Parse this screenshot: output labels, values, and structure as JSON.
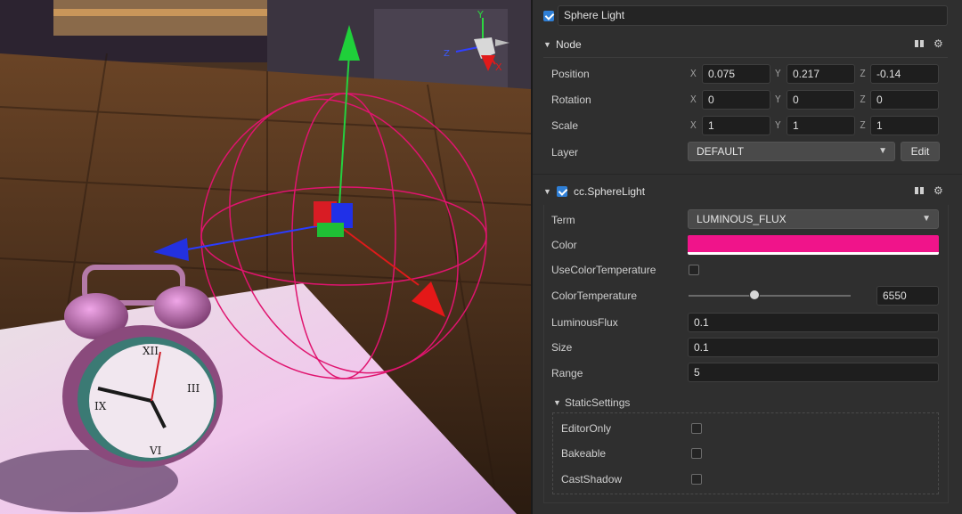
{
  "colors": {
    "sphere_color": "#f0148a",
    "accent": "#2f7fd6"
  },
  "header": {
    "name": "Sphere Light"
  },
  "node": {
    "title": "Node",
    "position": {
      "label": "Position",
      "x": "0.075",
      "y": "0.217",
      "z": "-0.14"
    },
    "rotation": {
      "label": "Rotation",
      "x": "0",
      "y": "0",
      "z": "0"
    },
    "scale": {
      "label": "Scale",
      "x": "1",
      "y": "1",
      "z": "1"
    },
    "layer": {
      "label": "Layer",
      "value": "DEFAULT",
      "edit_label": "Edit"
    },
    "axes": {
      "x": "X",
      "y": "Y",
      "z": "Z"
    }
  },
  "component": {
    "title": "cc.SphereLight",
    "term": {
      "label": "Term",
      "value": "LUMINOUS_FLUX"
    },
    "color": {
      "label": "Color"
    },
    "use_color_temperature": {
      "label": "UseColorTemperature"
    },
    "color_temperature": {
      "label": "ColorTemperature",
      "value": "6550",
      "slider_fraction": 0.4
    },
    "luminous_flux": {
      "label": "LuminousFlux",
      "value": "0.1"
    },
    "size": {
      "label": "Size",
      "value": "0.1"
    },
    "range": {
      "label": "Range",
      "value": "5"
    },
    "static_settings": {
      "title": "StaticSettings",
      "editor_only": {
        "label": "EditorOnly"
      },
      "bakeable": {
        "label": "Bakeable"
      },
      "cast_shadow": {
        "label": "CastShadow"
      }
    }
  },
  "gizmo": {
    "y_label": "Y",
    "x_label": "X",
    "z_label": "Z"
  },
  "icons": {
    "book": "book-icon",
    "gear": "gear-icon"
  }
}
